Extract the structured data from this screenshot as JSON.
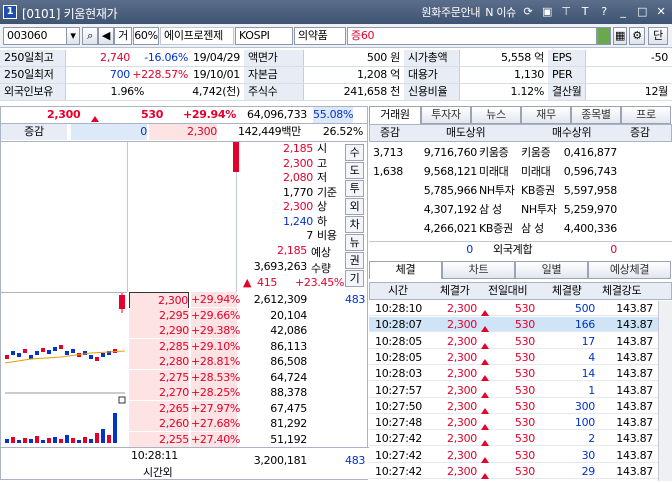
{
  "titlebar": {
    "number": "1",
    "title": "[0101] 키움현재가",
    "order_link": "원화주문안내",
    "news_link": "N 이슈",
    "icons": [
      "refresh-icon",
      "window-icon",
      "pin-icon",
      "text-size-icon",
      "help-icon",
      "minimize-icon",
      "maximize-icon",
      "close-icon"
    ],
    "help": "?",
    "text": "T"
  },
  "toolbar": {
    "code": "003060",
    "market_tab": "거",
    "ratio": "60%",
    "stock_name": "에이프로젠제",
    "market": "KOSPI",
    "sector": "의약품",
    "margin": "증60",
    "end_btn": "단"
  },
  "info": {
    "row1": [
      {
        "label": "250일최고",
        "v1": "2,740",
        "v2": "-16.06%",
        "v3": "19/04/29"
      },
      {
        "label": "액면가",
        "value": "500 원"
      },
      {
        "label": "시가총액",
        "value": "5,558 억"
      },
      {
        "label": "EPS",
        "value": "-50"
      }
    ],
    "row2": [
      {
        "label": "250일최저",
        "v1": "700",
        "v2": "+228.57%",
        "v3": "19/10/01"
      },
      {
        "label": "자본금",
        "value": "1,208 억"
      },
      {
        "label": "대용가",
        "value": "1,130"
      },
      {
        "label": "PER",
        "value": ""
      }
    ],
    "row3": [
      {
        "label": "외국인보유",
        "v1": "1.96%",
        "v2": "4,742(천)"
      },
      {
        "label": "주식수",
        "value": "241,658 천"
      },
      {
        "label": "신용비율",
        "value": "1.12%"
      },
      {
        "label": "결산월",
        "value": "12월"
      }
    ]
  },
  "price": {
    "current": "2,300",
    "change": "530",
    "rate": "+29.94%",
    "volume": "64,096,733",
    "ratio": "55.08%"
  },
  "header": {
    "label": "증감",
    "left": "0",
    "right": "2,300",
    "amount": "142,449백만",
    "pct": "26.52%"
  },
  "side_buttons": [
    "수",
    "도",
    "투",
    "외",
    "차",
    "뉴",
    "권",
    "기"
  ],
  "summary": [
    {
      "v": "2,185",
      "k": "시"
    },
    {
      "v": "2,300",
      "k": "고"
    },
    {
      "v": "2,080",
      "k": "저"
    },
    {
      "v": "1,770",
      "k": "기준"
    },
    {
      "v": "2,300",
      "k": "상"
    },
    {
      "v": "1,240",
      "k": "하"
    },
    {
      "v": "7",
      "k": "비용"
    }
  ],
  "expected": {
    "price": "2,185",
    "label": "예상",
    "qty": "3,693,263",
    "qty_label": "수량",
    "change": "415",
    "rate": "+23.45%"
  },
  "bids": [
    {
      "price": "2,300",
      "rate": "+29.94%",
      "qty": "2,612,309",
      "extra": "483"
    },
    {
      "price": "2,295",
      "rate": "+29.66%",
      "qty": "20,104"
    },
    {
      "price": "2,290",
      "rate": "+29.38%",
      "qty": "42,086"
    },
    {
      "price": "2,285",
      "rate": "+29.10%",
      "qty": "86,113"
    },
    {
      "price": "2,280",
      "rate": "+28.81%",
      "qty": "86,508"
    },
    {
      "price": "2,275",
      "rate": "+28.53%",
      "qty": "64,724"
    },
    {
      "price": "2,270",
      "rate": "+28.25%",
      "qty": "88,378"
    },
    {
      "price": "2,265",
      "rate": "+27.97%",
      "qty": "67,475"
    },
    {
      "price": "2,260",
      "rate": "+27.68%",
      "qty": "81,292"
    },
    {
      "price": "2,255",
      "rate": "+27.40%",
      "qty": "51,192"
    }
  ],
  "footer": {
    "time": "10:28:11",
    "label": "시간외",
    "total": "3,200,181",
    "extra": "483"
  },
  "broker": {
    "tabs": [
      "거래원",
      "투자자",
      "뉴스",
      "재무",
      "종목별",
      "프로"
    ],
    "headers": {
      "change": "증감",
      "sell": "매도상위",
      "buy": "매수상위",
      "change2": "증감"
    },
    "rows": [
      {
        "chg": "3,713",
        "sq": "9,716,760",
        "sn": "키움증",
        "bn": "키움증",
        "bq": "0,416,877"
      },
      {
        "chg": "1,638",
        "sq": "9,568,121",
        "sn": "미래대",
        "bn": "미래대",
        "bq": "0,596,743"
      },
      {
        "chg": "",
        "sq": "5,785,966",
        "sn": "NH투자",
        "bn": "KB증권",
        "bq": "5,597,958"
      },
      {
        "chg": "",
        "sq": "4,307,192",
        "sn": "삼 성",
        "bn": "NH투자",
        "bq": "5,259,970"
      },
      {
        "chg": "",
        "sq": "4,266,021",
        "sn": "KB증권",
        "bn": "삼 성",
        "bq": "4,400,336"
      }
    ],
    "foreign": {
      "left": "0",
      "label": "외국계합",
      "right": "0"
    }
  },
  "trades": {
    "tabs": [
      "체결",
      "차트",
      "일별",
      "예상체결"
    ],
    "headers": [
      "시간",
      "체결가",
      "전일대비",
      "체결량",
      "체결강도"
    ],
    "rows": [
      {
        "t": "10:28:10",
        "p": "2,300",
        "c": "530",
        "q": "500",
        "s": "143.87",
        "hl": false
      },
      {
        "t": "10:28:07",
        "p": "2,300",
        "c": "530",
        "q": "166",
        "s": "143.87",
        "hl": true
      },
      {
        "t": "10:28:05",
        "p": "2,300",
        "c": "530",
        "q": "17",
        "s": "143.87",
        "hl": false
      },
      {
        "t": "10:28:05",
        "p": "2,300",
        "c": "530",
        "q": "4",
        "s": "143.87",
        "hl": false
      },
      {
        "t": "10:28:03",
        "p": "2,300",
        "c": "530",
        "q": "14",
        "s": "143.87",
        "hl": false
      },
      {
        "t": "10:27:57",
        "p": "2,300",
        "c": "530",
        "q": "1",
        "s": "143.87",
        "hl": false
      },
      {
        "t": "10:27:50",
        "p": "2,300",
        "c": "530",
        "q": "300",
        "s": "143.87",
        "hl": false
      },
      {
        "t": "10:27:48",
        "p": "2,300",
        "c": "530",
        "q": "100",
        "s": "143.87",
        "hl": false
      },
      {
        "t": "10:27:42",
        "p": "2,300",
        "c": "530",
        "q": "2",
        "s": "143.87",
        "hl": false
      },
      {
        "t": "10:27:42",
        "p": "2,300",
        "c": "530",
        "q": "30",
        "s": "143.87",
        "hl": false
      },
      {
        "t": "10:27:42",
        "p": "2,300",
        "c": "530",
        "q": "29",
        "s": "143.87",
        "hl": false
      }
    ]
  },
  "colors": {
    "up": "#e4002b",
    "down": "#0033cc",
    "ask_bg": "#dde9f9",
    "bid_bg": "#fde3e3",
    "highlight": "#cfe5f7"
  }
}
